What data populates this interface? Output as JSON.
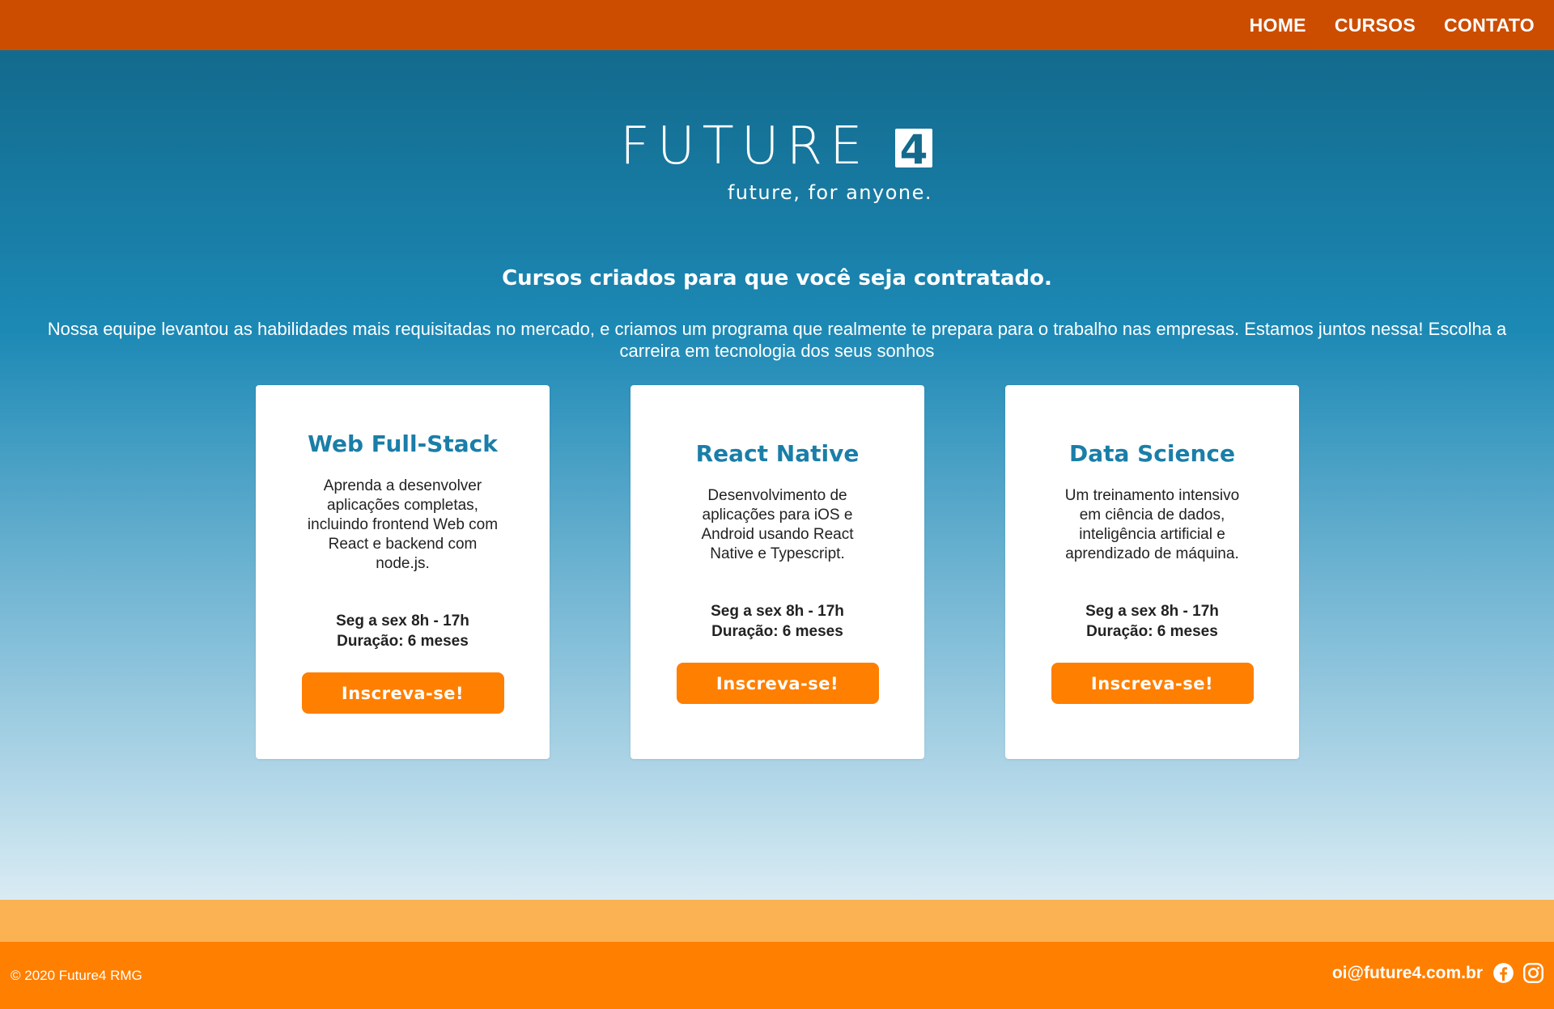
{
  "nav": {
    "items": [
      {
        "label": "HOME"
      },
      {
        "label": "CURSOS"
      },
      {
        "label": "CONTATO"
      }
    ]
  },
  "brand": {
    "name": "FUTURE4",
    "word": "FUTURE",
    "digit": "4",
    "tagline": "future, for anyone."
  },
  "hero": {
    "headline": "Cursos criados para que você seja contratado.",
    "intro": "Nossa equipe levantou as habilidades mais requisitadas no mercado, e criamos um programa que realmente te prepara para o trabalho nas empresas. Estamos juntos nessa! Escolha a carreira em tecnologia dos seus sonhos"
  },
  "courses": [
    {
      "title": "Web Full-Stack",
      "description": "Aprenda a desenvolver aplicações completas, incluindo frontend Web com React e backend com node.js.",
      "schedule": "Seg a sex 8h - 17h",
      "duration": "Duração: 6 meses",
      "button": "Inscreva-se!"
    },
    {
      "title": "React Native",
      "description": "Desenvolvimento de aplicações para iOS e Android usando React Native e Typescript.",
      "schedule": "Seg a sex 8h - 17h",
      "duration": "Duração: 6 meses",
      "button": "Inscreva-se!"
    },
    {
      "title": "Data Science",
      "description": "Um treinamento intensivo em ciência de dados, inteligência artificial e aprendizado de máquina.",
      "schedule": "Seg a sex 8h - 17h",
      "duration": "Duração: 6 meses",
      "button": "Inscreva-se!"
    }
  ],
  "footer": {
    "copyright": "© 2020 Future4 RMG",
    "email": "oi@future4.com.br",
    "social": [
      {
        "icon": "facebook-icon"
      },
      {
        "icon": "instagram-icon"
      }
    ]
  },
  "colors": {
    "topbar": "#cd4d00",
    "hero_top": "#136a8d",
    "hero_bottom": "#d9ebf4",
    "card_title": "#1a7ea8",
    "button": "#ff7f00",
    "footer_band": "#fab252",
    "footer": "#ff7f00"
  }
}
